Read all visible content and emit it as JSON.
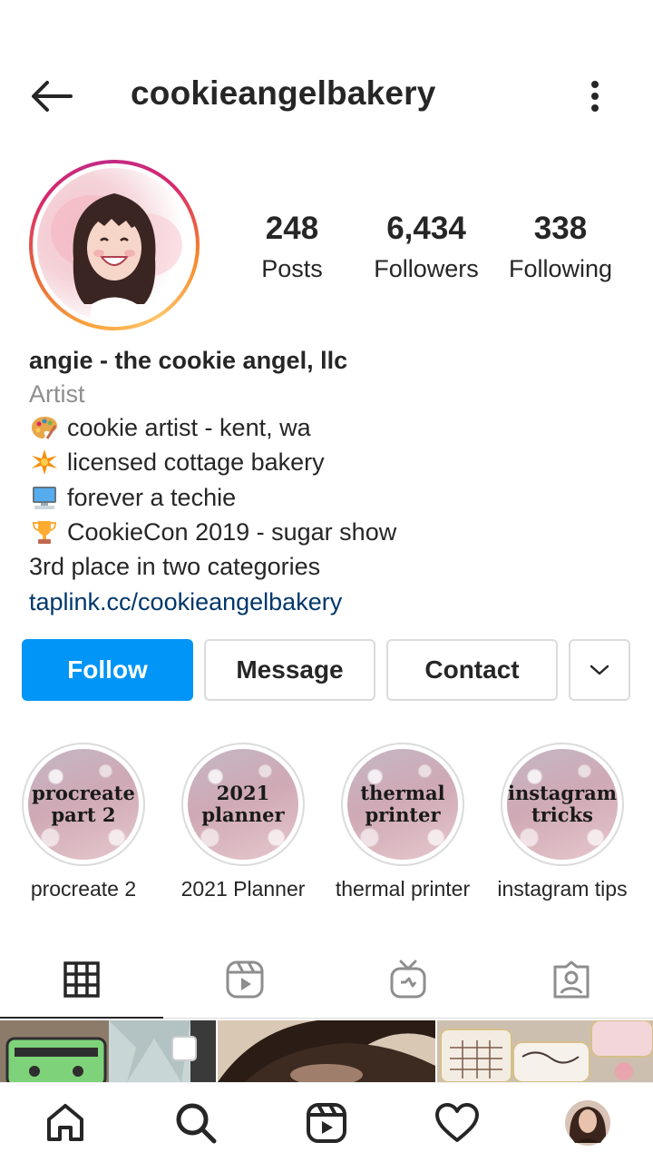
{
  "header": {
    "username": "cookieangelbakery"
  },
  "profile": {
    "stats": [
      {
        "value": "248",
        "label": "Posts"
      },
      {
        "value": "6,434",
        "label": "Followers"
      },
      {
        "value": "338",
        "label": "Following"
      }
    ],
    "display_name": "angie - the cookie angel, llc",
    "category": "Artist",
    "bio_lines": [
      {
        "icon": "palette-icon",
        "text": "cookie artist - kent, wa"
      },
      {
        "icon": "sparkle-icon",
        "text": "licensed cottage bakery"
      },
      {
        "icon": "computer-icon",
        "text": "forever a techie"
      },
      {
        "icon": "trophy-icon",
        "text": "CookieCon 2019 - sugar show"
      },
      {
        "icon": "",
        "text": "3rd place in two categories"
      }
    ],
    "link": "taplink.cc/cookieangelbakery"
  },
  "actions": {
    "follow": "Follow",
    "message": "Message",
    "contact": "Contact"
  },
  "highlights": [
    {
      "cover_line1": "procreate",
      "cover_line2": "part 2",
      "label": "procreate 2"
    },
    {
      "cover_line1": "2021",
      "cover_line2": "planner",
      "label": "2021 Planner"
    },
    {
      "cover_line1": "thermal",
      "cover_line2": "printer",
      "label": "thermal printer"
    },
    {
      "cover_line1": "instagram",
      "cover_line2": "tricks",
      "label": "instagram tips"
    }
  ],
  "tabs": [
    "grid-icon",
    "reels-icon",
    "igtv-icon",
    "tagged-icon"
  ],
  "bottom_nav": [
    "home-icon",
    "search-icon",
    "reels-icon",
    "heart-icon",
    "profile-avatar"
  ],
  "colors": {
    "accent": "#0095f6",
    "link": "#00376b",
    "text": "#262626",
    "muted": "#8e8e8e",
    "border": "#dbdbdb"
  }
}
